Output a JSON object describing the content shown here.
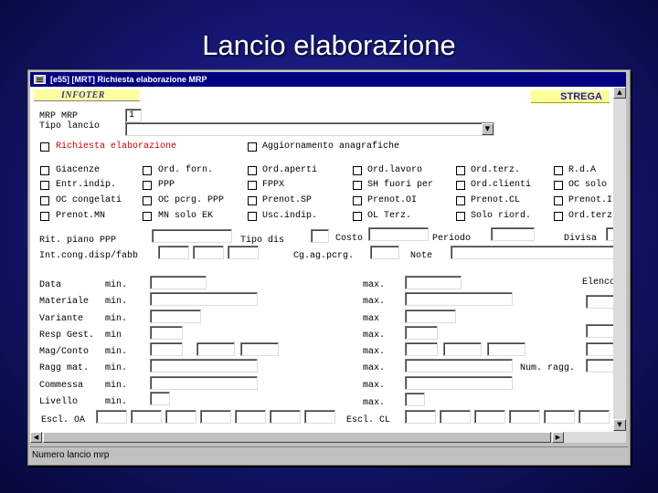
{
  "slide": {
    "title": "Lancio elaborazione"
  },
  "window": {
    "title": "[e55] [MRT] Richiesta elaborazione MRP"
  },
  "header": {
    "logo_text": "INFOTER",
    "brand_text": "STREGA"
  },
  "top": {
    "mrp_label": "MRP MRP",
    "mrp_value": "1",
    "tipo_lancio_label": "Tipo lancio",
    "richiesta_label": "Richiesta elaborazione",
    "aggiornamento_label": "Aggiornamento anagrafiche"
  },
  "checkboxes": {
    "col1": [
      "Giacenze",
      "Entr.indip.",
      "OC congelati",
      "Prenot.MN"
    ],
    "col2": [
      "Ord. forn.",
      "PPP",
      "OC pcrg. PPP",
      "MN solo EK"
    ],
    "col3": [
      "Ord.aperti",
      "FPPX",
      "Prenot.SP",
      "Usc.indip."
    ],
    "col4": [
      "Ord.lavoro",
      "SH fuori per",
      "Prenot.OI",
      "OL Terz."
    ],
    "col5": [
      "Ord.terz.",
      "Ord.clienti",
      "Prenot.CL",
      "Solo riord."
    ],
    "col6": [
      "R.d.A",
      "OC solo",
      "Prenot.I",
      "Ord.terz"
    ]
  },
  "params": {
    "rit_piano_label": "Rit. piano PPP",
    "tipo_dis_label": "Tipo dis",
    "costo_label": "Costo",
    "periodo_label": "Periodo",
    "divisa_label": "Divisa",
    "int_cong_label": "Int.cong.disp/fabb",
    "cg_ag_label": "Cg.ag.pcrg.",
    "note_label": "Note"
  },
  "ranges": {
    "min_label": "min.",
    "max_label": "max.",
    "max_label_short": "max",
    "elenco_label": "Elenco",
    "num_ragg_label": "Num. ragg.",
    "rows": [
      {
        "label": "Data",
        "min": "min."
      },
      {
        "label": "Materiale",
        "min": "min."
      },
      {
        "label": "Variante",
        "min": "min."
      },
      {
        "label": "Resp Gest.",
        "min": "min"
      },
      {
        "label": "Mag/Conto",
        "min": "min."
      },
      {
        "label": "Ragg mat.",
        "min": "min."
      },
      {
        "label": "Commessa",
        "min": "min."
      },
      {
        "label": "Livello",
        "min": "min."
      }
    ]
  },
  "bottom": {
    "escl_oa_label": "Escl. OA",
    "escl_cl_label": "Escl. CL"
  },
  "status": {
    "text": "Numero lancio mrp"
  }
}
